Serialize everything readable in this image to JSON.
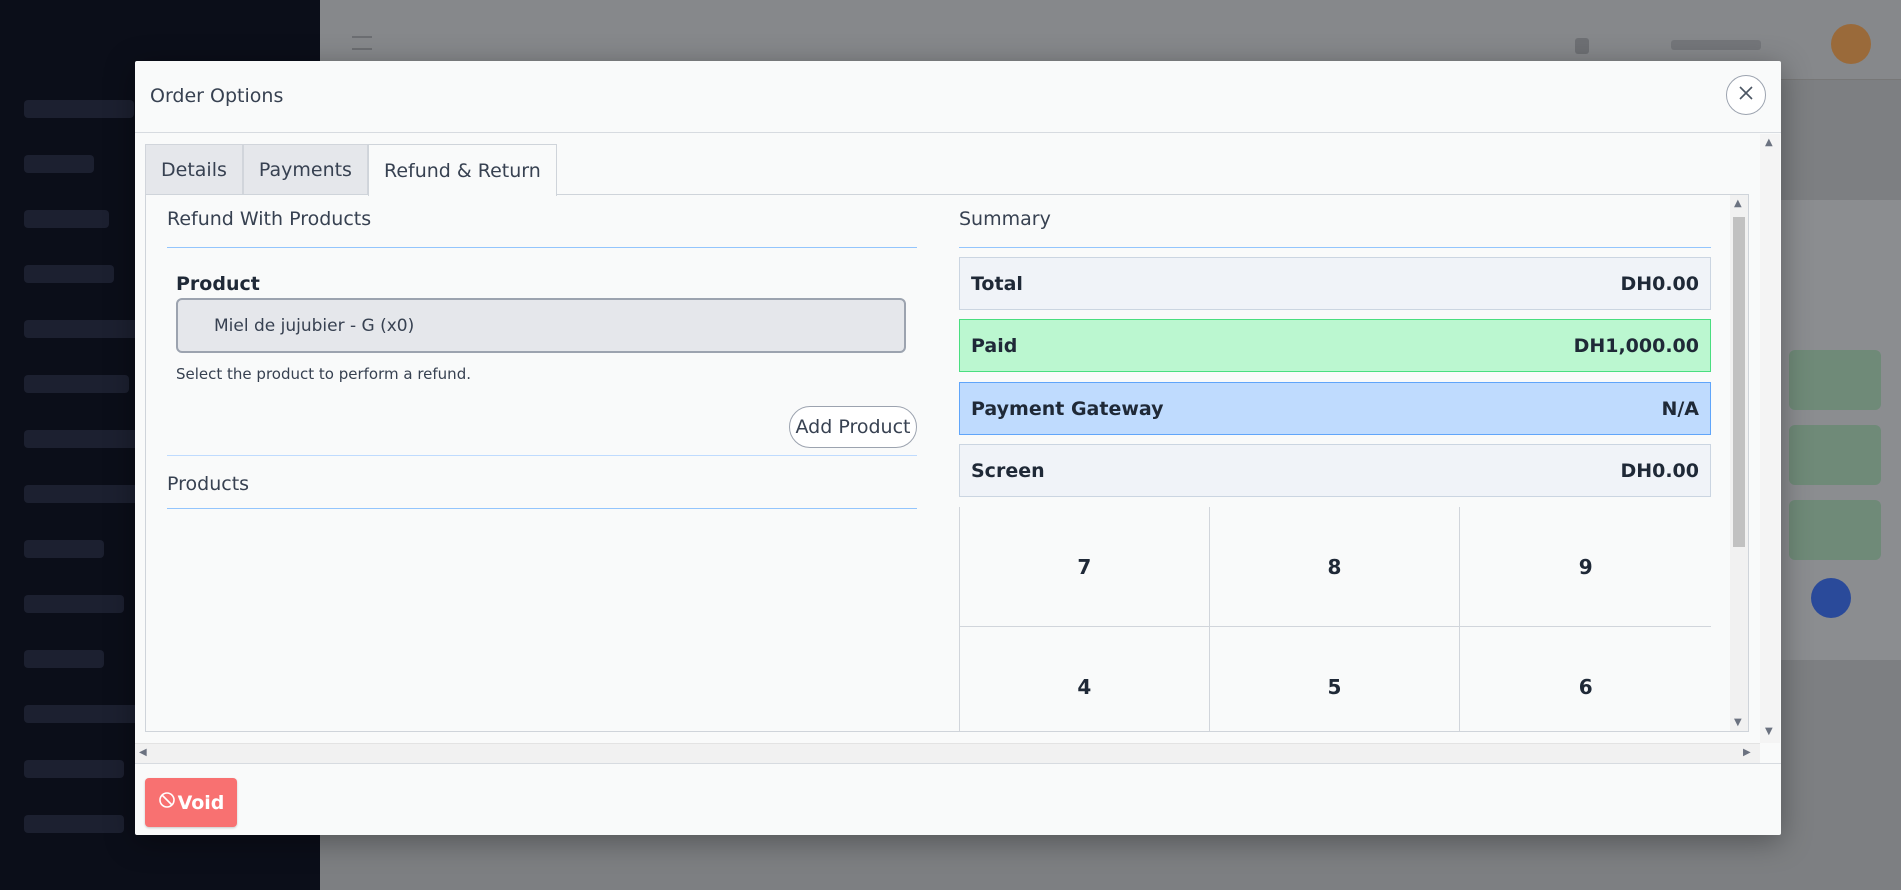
{
  "modal": {
    "title": "Order Options",
    "close_icon": "close-icon"
  },
  "tabs": [
    {
      "label": "Details",
      "active": false
    },
    {
      "label": "Payments",
      "active": false
    },
    {
      "label": "Refund & Return",
      "active": true
    }
  ],
  "refund": {
    "section_title": "Refund With Products",
    "product_label": "Product",
    "product_value": "Miel de jujubier - G (x0)",
    "help_text": "Select the product to perform a refund.",
    "add_product_label": "Add Product",
    "products_title": "Products"
  },
  "summary": {
    "title": "Summary",
    "rows": [
      {
        "label": "Total",
        "value": "DH0.00"
      },
      {
        "label": "Paid",
        "value": "DH1,000.00"
      },
      {
        "label": "Payment Gateway",
        "value": "N/A"
      },
      {
        "label": "Screen",
        "value": "DH0.00"
      }
    ],
    "numpad": [
      "7",
      "8",
      "9",
      "4",
      "5",
      "6"
    ]
  },
  "footer": {
    "void_label": "Void",
    "void_icon": "ban-icon"
  },
  "colors": {
    "paid_bg": "#bbf7d0",
    "gateway_bg": "#bfdbfe",
    "void_bg": "#f87171",
    "section_line": "#93c5fd"
  }
}
